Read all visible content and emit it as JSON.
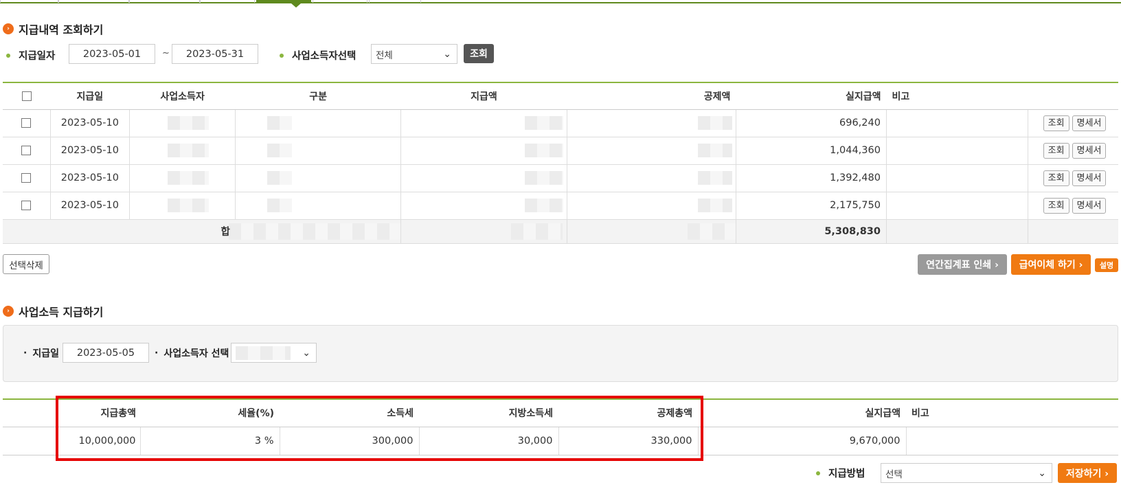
{
  "search_section": {
    "title": "지급내역 조회하기",
    "pay_date_label": "지급일자",
    "date_from": "2023-05-01",
    "date_sep": "~",
    "date_to": "2023-05-31",
    "earner_label": "사업소득자선택",
    "earner_selected": "전체",
    "search_button": "조회"
  },
  "list_table": {
    "headers": [
      "지급일",
      "사업소득자",
      "구분",
      "지급액",
      "공제액",
      "실지급액",
      "비고"
    ],
    "rows": [
      {
        "date": "2023-05-10",
        "net": "696,240"
      },
      {
        "date": "2023-05-10",
        "net": "1,044,360"
      },
      {
        "date": "2023-05-10",
        "net": "1,392,480"
      },
      {
        "date": "2023-05-10",
        "net": "2,175,750"
      }
    ],
    "row_view_button": "조회",
    "row_statement_button": "명세서",
    "sum_label": "합",
    "sum_net": "5,308,830"
  },
  "actions": {
    "delete_selected": "선택삭제",
    "annual_print": "연간집계표 인쇄 ›",
    "salary_transfer": "급여이체 하기 ›",
    "help_badge": "설명"
  },
  "pay_section": {
    "title": "사업소득 지급하기",
    "pay_date_label": "지급일",
    "pay_date": "2023-05-05",
    "earner_label": "사업소득자 선택"
  },
  "calc_table": {
    "headers": [
      "지급총액",
      "세율(%)",
      "소득세",
      "지방소득세",
      "공제총액",
      "실지급액",
      "비고"
    ],
    "values": [
      "10,000,000",
      "3 %",
      "300,000",
      "30,000",
      "330,000",
      "9,670,000",
      ""
    ]
  },
  "footer": {
    "method_label": "지급방법",
    "method_selected": "선택",
    "save_button": "저장하기 ›"
  },
  "colors": {
    "accent_green": "#5f8a1e",
    "orange": "#f07a12",
    "highlight_red": "#e60000"
  }
}
